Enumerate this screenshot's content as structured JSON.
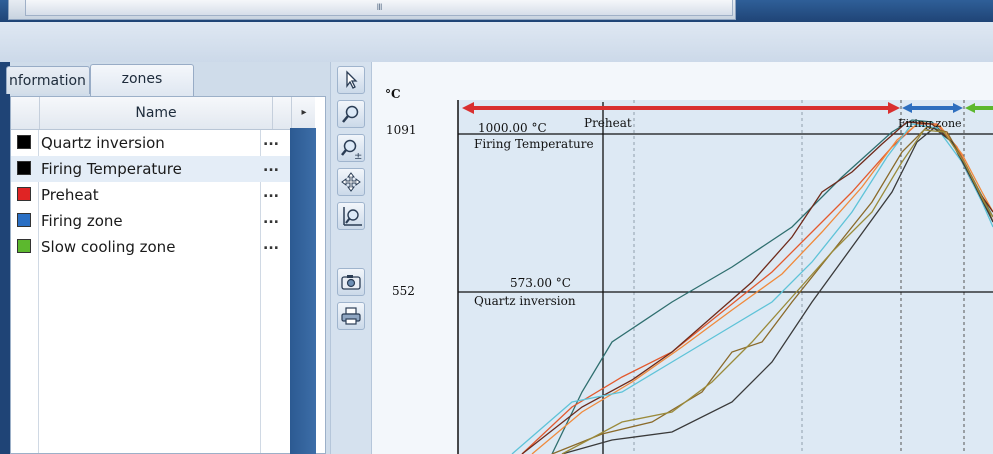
{
  "top_scrollbar": {
    "grip": "III"
  },
  "tabs": [
    {
      "label": "nformation",
      "active": false
    },
    {
      "label": "zones",
      "active": true
    }
  ],
  "grid": {
    "header_name": "Name",
    "header_arrow": "▸",
    "rows": [
      {
        "label": "Quartz inversion",
        "color": "#000000",
        "more": "...",
        "selected": false
      },
      {
        "label": "Firing Temperature",
        "color": "#000000",
        "more": "...",
        "selected": true
      },
      {
        "label": "Preheat",
        "color": "#e02424",
        "more": "...",
        "selected": false
      },
      {
        "label": "Firing zone",
        "color": "#2a6fc4",
        "more": "...",
        "selected": false
      },
      {
        "label": "Slow cooling zone",
        "color": "#5cb82e",
        "more": "...",
        "selected": false
      }
    ]
  },
  "tools": [
    {
      "icon": "pointer-icon"
    },
    {
      "icon": "zoom-icon"
    },
    {
      "icon": "zoom-plus-minus-icon"
    },
    {
      "icon": "pan-icon"
    },
    {
      "icon": "zoom-fit-icon"
    },
    {
      "icon": "camera-icon"
    },
    {
      "icon": "print-icon"
    }
  ],
  "chart": {
    "unit": "°C",
    "yticks": [
      "1091",
      "552"
    ],
    "zones": {
      "preheat_label": "Preheat",
      "firing_label": "Firing zone"
    },
    "annotations": {
      "firing_value": "1000.00 °C",
      "firing_name": "Firing Temperature",
      "quartz_value": "573.00 °C",
      "quartz_name": "Quartz inversion"
    },
    "colors": {
      "preheat": "#d93030",
      "firing": "#2e6fbf",
      "cooling": "#5cb82e"
    }
  }
}
